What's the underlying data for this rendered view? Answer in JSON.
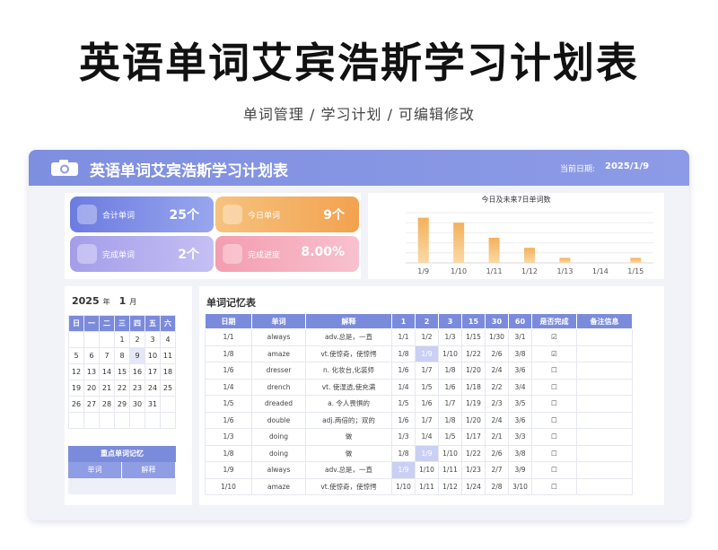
{
  "page": {
    "title": "英语单词艾宾浩斯学习计划表",
    "subtitle": "单词管理 / 学习计划 / 可编辑修改"
  },
  "sheet": {
    "title": "英语单词艾宾浩斯学习计划表",
    "date_label": "当前日期:",
    "date_value": "2025/1/9",
    "accent_color": "#7f8fe0"
  },
  "stats": {
    "total": {
      "label": "合计单词",
      "value": "25个",
      "icon": "bulb-icon"
    },
    "today": {
      "label": "今日单词",
      "value": "9个",
      "icon": "note-icon"
    },
    "done": {
      "label": "完成单词",
      "value": "2个",
      "icon": "storefront-icon"
    },
    "progress": {
      "label": "完成进度",
      "value": "8.00%",
      "icon": "chart-icon"
    }
  },
  "chart_data": {
    "type": "bar",
    "title": "今日及未来7日单词数",
    "categories": [
      "1/9",
      "1/10",
      "1/11",
      "1/12",
      "1/13",
      "1/14",
      "1/15"
    ],
    "values": [
      9,
      8,
      5,
      3,
      1,
      0,
      1
    ],
    "xlabel": "",
    "ylabel": "",
    "ylim": [
      0,
      10
    ],
    "grid": true,
    "bar_color": "#f4b05a"
  },
  "calendar": {
    "year": "2025",
    "year_unit": "年",
    "month": "1",
    "month_unit": "月",
    "weekdays": [
      "日",
      "一",
      "二",
      "三",
      "四",
      "五",
      "六"
    ],
    "weeks": [
      [
        "",
        "",
        "",
        "1",
        "2",
        "3",
        "4"
      ],
      [
        "5",
        "6",
        "7",
        "8",
        "9",
        "10",
        "11"
      ],
      [
        "12",
        "13",
        "14",
        "15",
        "16",
        "17",
        "18"
      ],
      [
        "19",
        "20",
        "21",
        "22",
        "23",
        "24",
        "25"
      ],
      [
        "26",
        "27",
        "28",
        "29",
        "30",
        "31",
        ""
      ],
      [
        "",
        "",
        "",
        "",
        "",
        "",
        ""
      ]
    ],
    "selected_day": "9"
  },
  "key_words": {
    "title": "重点单词记忆",
    "columns": [
      "单词",
      "解释"
    ]
  },
  "memory": {
    "title": "单词记忆表",
    "columns": [
      "日期",
      "单词",
      "解释",
      "1",
      "2",
      "3",
      "15",
      "30",
      "60",
      "是否完成",
      "备注信息"
    ],
    "rows": [
      [
        "1/1",
        "always",
        "adv.总是，一直",
        "1/1",
        "1/2",
        "1/3",
        "1/15",
        "1/30",
        "3/1",
        "☑",
        ""
      ],
      [
        "1/8",
        "amaze",
        "vt.使惊奇，使惊愕",
        "1/8",
        "1/9",
        "1/10",
        "1/22",
        "2/6",
        "3/8",
        "☑",
        ""
      ],
      [
        "1/6",
        "dresser",
        "n. 化妆台,化装师",
        "1/6",
        "1/7",
        "1/8",
        "1/20",
        "2/4",
        "3/6",
        "☐",
        ""
      ],
      [
        "1/4",
        "drench",
        "vt. 使湿透,使充满",
        "1/4",
        "1/5",
        "1/6",
        "1/18",
        "2/2",
        "3/4",
        "☐",
        ""
      ],
      [
        "1/5",
        "dreaded",
        "a. 令人畏惧的",
        "1/5",
        "1/6",
        "1/7",
        "1/19",
        "2/3",
        "3/5",
        "☐",
        ""
      ],
      [
        "1/6",
        "double",
        "adj.两倍的；双的",
        "1/6",
        "1/7",
        "1/8",
        "1/20",
        "2/4",
        "3/6",
        "☐",
        ""
      ],
      [
        "1/3",
        "doing",
        "做",
        "1/3",
        "1/4",
        "1/5",
        "1/17",
        "2/1",
        "3/3",
        "☐",
        ""
      ],
      [
        "1/8",
        "doing",
        "做",
        "1/8",
        "1/9",
        "1/10",
        "1/22",
        "2/6",
        "3/8",
        "☐",
        ""
      ],
      [
        "1/9",
        "always",
        "adv.总是，一直",
        "1/9",
        "1/10",
        "1/11",
        "1/23",
        "2/7",
        "3/9",
        "☐",
        ""
      ],
      [
        "1/10",
        "amaze",
        "vt.使惊奇，使惊愕",
        "1/10",
        "1/11",
        "1/12",
        "1/24",
        "2/8",
        "3/10",
        "☐",
        ""
      ]
    ],
    "highlight_date": "1/9"
  }
}
